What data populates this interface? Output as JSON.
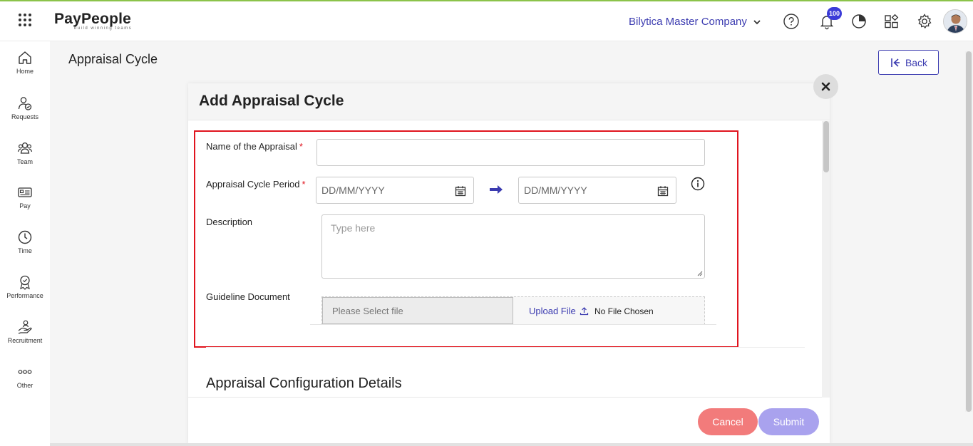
{
  "header": {
    "logo_text": "PayPeople",
    "logo_tagline": "build winning teams",
    "company_name": "Bilytica Master Company",
    "notification_count": "100"
  },
  "sidebar": {
    "items": [
      {
        "label": "Home",
        "icon": "home-icon"
      },
      {
        "label": "Requests",
        "icon": "requests-icon"
      },
      {
        "label": "Team",
        "icon": "team-icon"
      },
      {
        "label": "Pay",
        "icon": "pay-icon"
      },
      {
        "label": "Time",
        "icon": "clock-icon"
      },
      {
        "label": "Performance",
        "icon": "badge-icon"
      },
      {
        "label": "Recruitment",
        "icon": "hand-icon"
      },
      {
        "label": "Other",
        "icon": "more-icon"
      }
    ]
  },
  "page": {
    "title": "Appraisal Cycle",
    "back_label": "Back"
  },
  "modal": {
    "title": "Add Appraisal Cycle",
    "fields": {
      "name_label": "Name of the Appraisal",
      "name_value": "",
      "period_label": "Appraisal Cycle Period",
      "start_placeholder": "DD/MM/YYYY",
      "end_placeholder": "DD/MM/YYYY",
      "description_label": "Description",
      "description_placeholder": "Type here",
      "guideline_label": "Guideline Document",
      "file_placeholder": "Please Select file",
      "upload_label": "Upload File",
      "no_file_text": "No File Chosen"
    },
    "section_title": "Appraisal Configuration Details",
    "cancel_label": "Cancel",
    "submit_label": "Submit"
  },
  "colors": {
    "accent": "#3b3bb0",
    "highlight": "#e0141e",
    "cancel": "#f27b7b",
    "submit": "#a9a2ee"
  }
}
